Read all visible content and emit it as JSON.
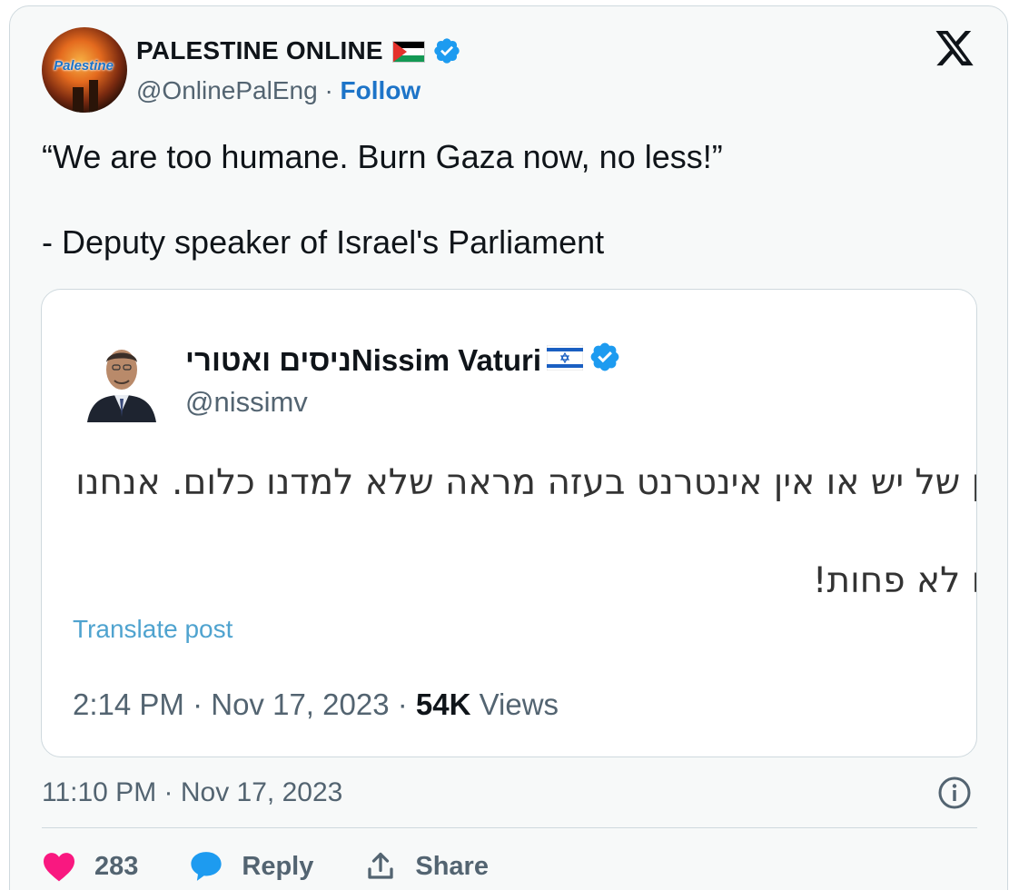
{
  "author": {
    "name": "PALESTINE ONLINE",
    "flag_icon": "palestine-flag-icon",
    "verified_icon": "verified-badge-icon",
    "handle": "@OnlinePalEng",
    "separator": "·",
    "follow_label": "Follow",
    "avatar_label": "Palestine"
  },
  "platform_icon": "x-logo-icon",
  "post": {
    "line1": "“We are too humane. Burn Gaza now, no less!”",
    "line2": "- Deputy speaker of Israel's Parliament"
  },
  "quoted": {
    "name": "ניסים ואטוריNissim Vaturi",
    "flag_icon": "israel-flag-icon",
    "verified_icon": "verified-badge-icon",
    "handle": "@nissimv",
    "text_line1": "ין של יש או אין אינטרנט בעזה מראה שלא למדנו כלום. אנחנו",
    "text_line2": "יו לא פחות!",
    "translate_label": "Translate post",
    "time": "2:14 PM",
    "date": "Nov 17, 2023",
    "views_count": "54K",
    "views_label": "Views",
    "separator": "·"
  },
  "timestamp": {
    "time": "11:10 PM",
    "separator": "·",
    "date": "Nov 17, 2023"
  },
  "actions": {
    "likes_count": "283",
    "reply_label": "Reply",
    "share_label": "Share"
  },
  "colors": {
    "accent_blue": "#1d74c8",
    "verified_blue": "#1d9bf0",
    "like_pink": "#f91880",
    "muted_gray": "#536471",
    "card_bg": "#f7f9f9"
  }
}
